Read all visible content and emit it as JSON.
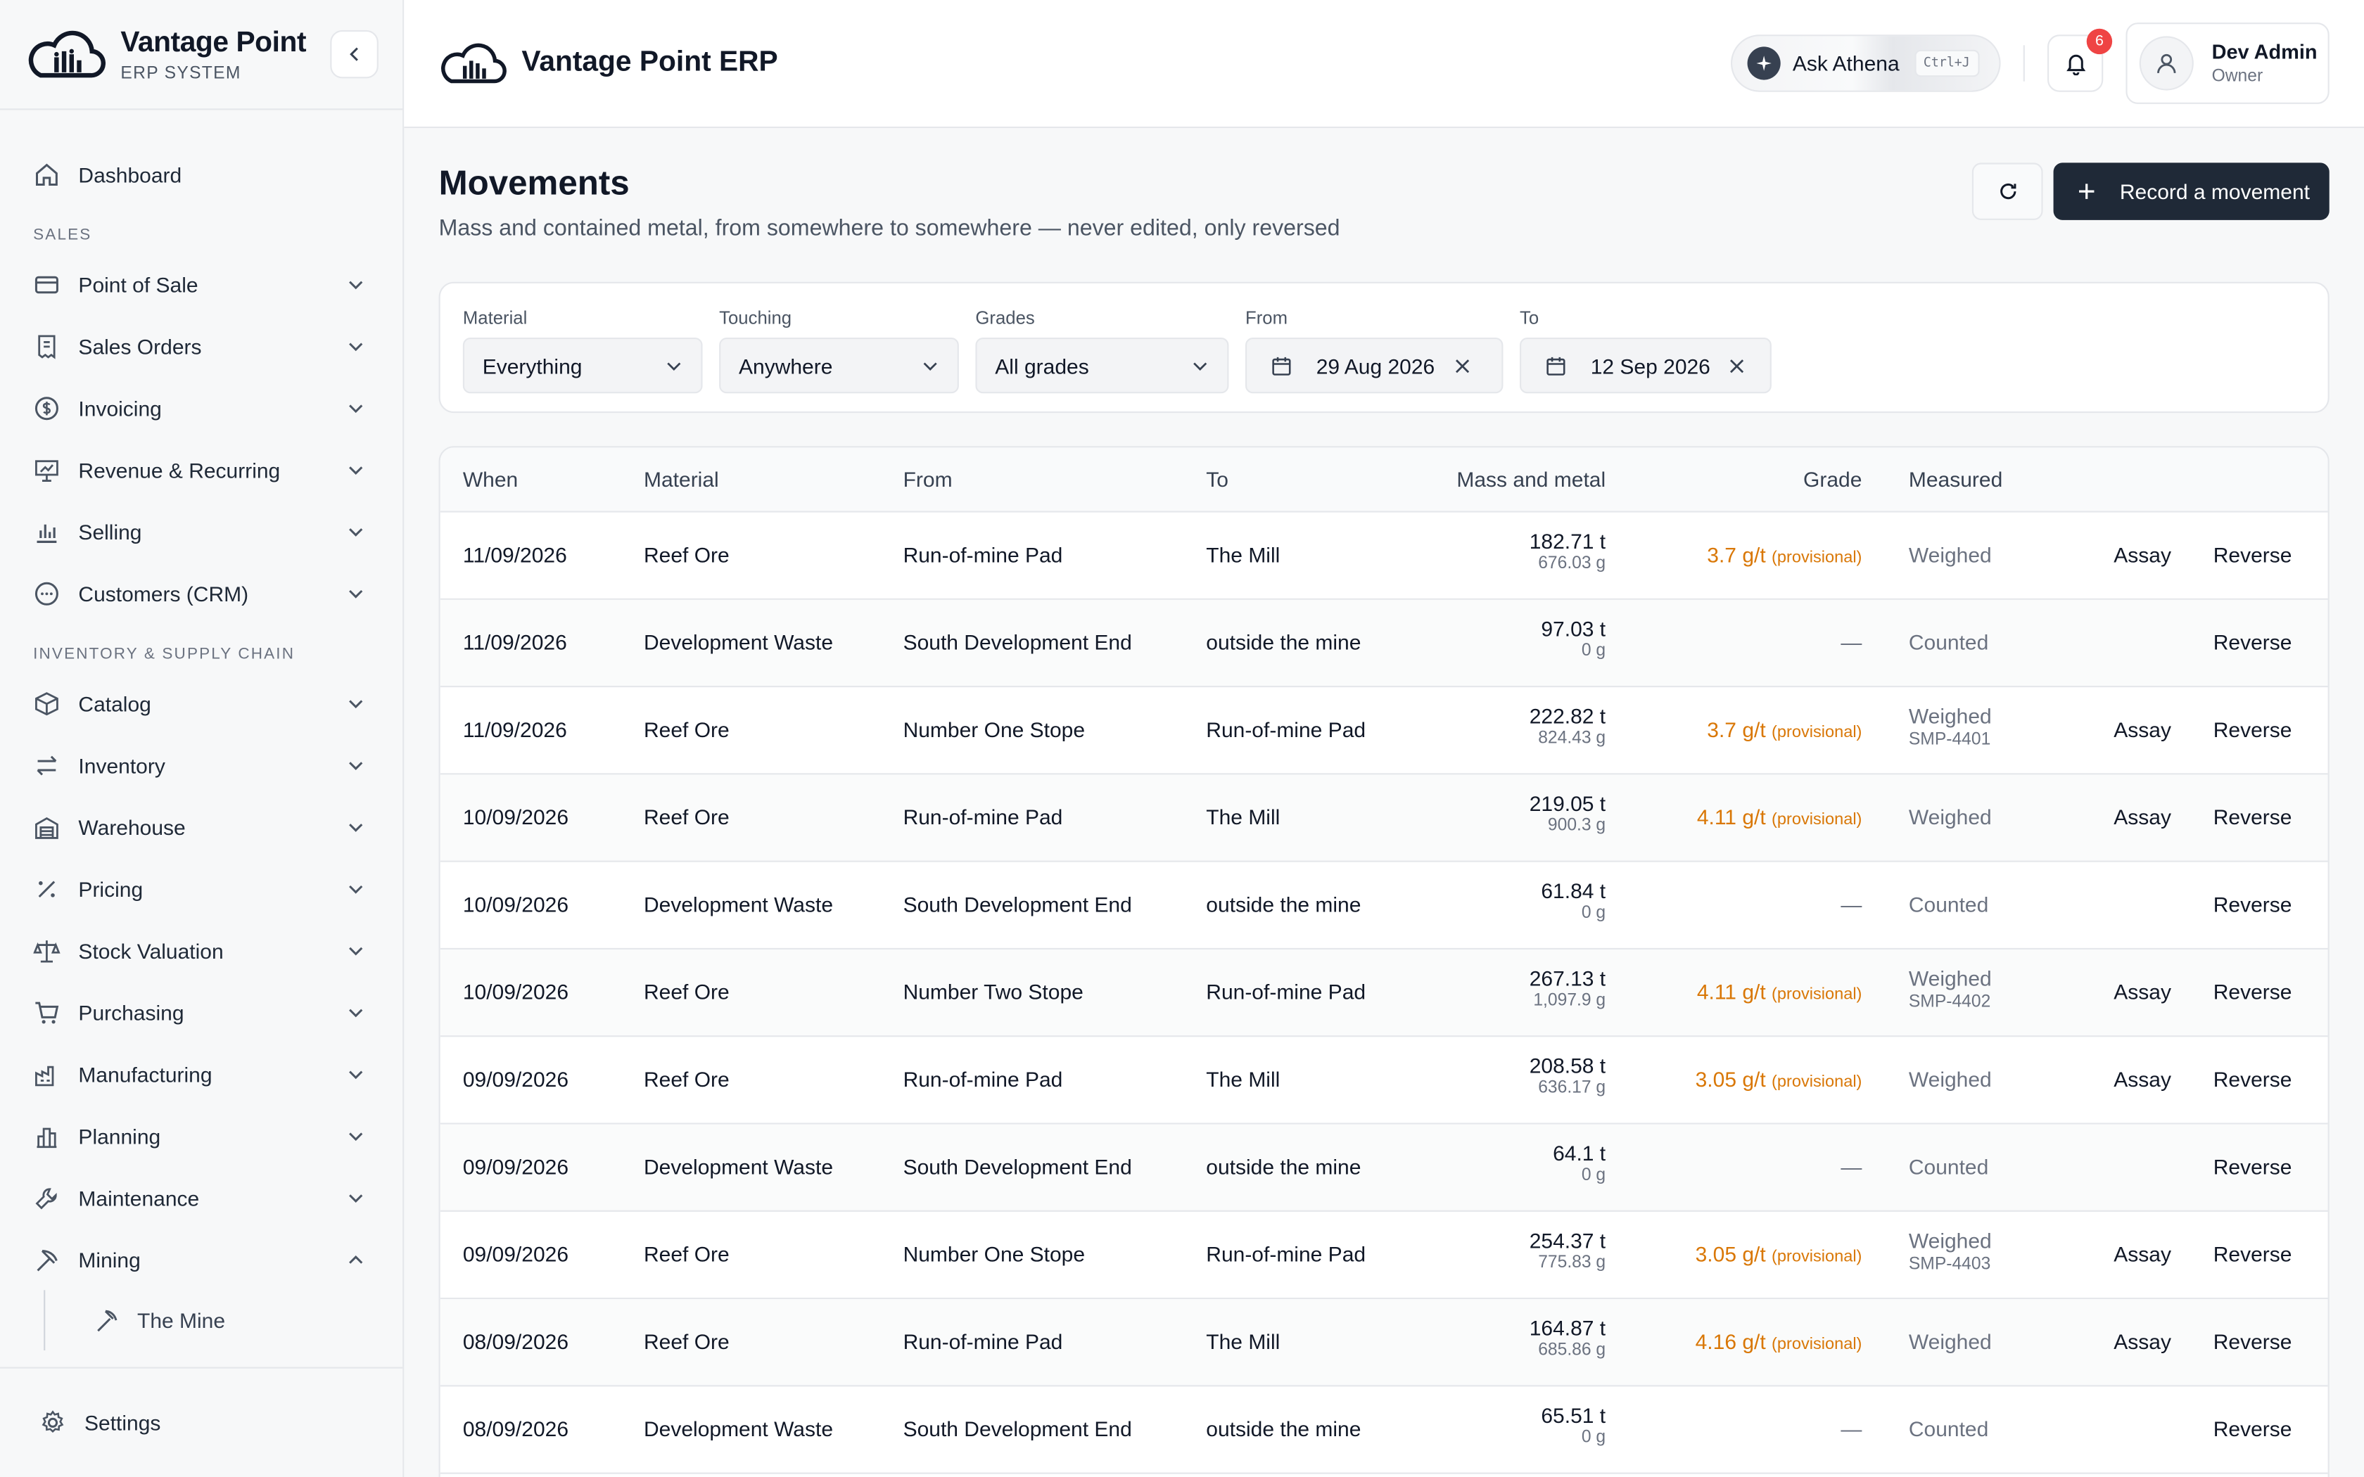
{
  "brand": {
    "title": "Vantage Point",
    "subtitle": "ERP SYSTEM"
  },
  "header": {
    "title": "Vantage Point ERP",
    "ask_label": "Ask Athena",
    "ask_shortcut": "Ctrl+J",
    "notification_count": "6",
    "user_name": "Dev Admin",
    "user_role": "Owner"
  },
  "sidebar": {
    "dashboard": "Dashboard",
    "sales_label": "SALES",
    "sales_items": [
      {
        "label": "Point of Sale",
        "icon": "credit-card-icon"
      },
      {
        "label": "Sales Orders",
        "icon": "receipt-icon"
      },
      {
        "label": "Invoicing",
        "icon": "dollar-circle-icon"
      },
      {
        "label": "Revenue & Recurring",
        "icon": "presentation-chart-icon"
      },
      {
        "label": "Selling",
        "icon": "bar-chart-icon"
      },
      {
        "label": "Customers (CRM)",
        "icon": "chat-icon"
      }
    ],
    "inventory_label": "INVENTORY & SUPPLY CHAIN",
    "inventory_items": [
      {
        "label": "Catalog",
        "icon": "box-icon"
      },
      {
        "label": "Inventory",
        "icon": "arrows-icon"
      },
      {
        "label": "Warehouse",
        "icon": "warehouse-icon"
      },
      {
        "label": "Pricing",
        "icon": "percent-icon"
      },
      {
        "label": "Stock Valuation",
        "icon": "scale-icon"
      },
      {
        "label": "Purchasing",
        "icon": "cart-icon"
      },
      {
        "label": "Manufacturing",
        "icon": "factory-icon"
      },
      {
        "label": "Planning",
        "icon": "columns-icon"
      },
      {
        "label": "Maintenance",
        "icon": "wrench-icon"
      },
      {
        "label": "Mining",
        "icon": "pickaxe-icon"
      }
    ],
    "sub_item": "The Mine",
    "settings": "Settings"
  },
  "page": {
    "title": "Movements",
    "subtitle": "Mass and contained metal, from somewhere to somewhere — never edited, only reversed",
    "record_button": "Record a movement"
  },
  "filters": {
    "material_label": "Material",
    "material_value": "Everything",
    "touching_label": "Touching",
    "touching_value": "Anywhere",
    "grades_label": "Grades",
    "grades_value": "All grades",
    "from_label": "From",
    "from_value": "29 Aug 2026",
    "to_label": "To",
    "to_value": "12 Sep 2026"
  },
  "table": {
    "headers": {
      "when": "When",
      "material": "Material",
      "from": "From",
      "to": "To",
      "mass": "Mass and metal",
      "grade": "Grade",
      "measured": "Measured"
    },
    "assay_label": "Assay",
    "reverse_label": "Reverse",
    "rows": [
      {
        "when": "11/09/2026",
        "material": "Reef Ore",
        "from": "Run-of-mine Pad",
        "to": "The Mill",
        "mass": "182.71 t",
        "metal": "676.03 g",
        "grade": "3.7 g/t",
        "provisional": "(provisional)",
        "measured": "Weighed",
        "sample": "",
        "assay": true
      },
      {
        "when": "11/09/2026",
        "material": "Development Waste",
        "from": "South Development End",
        "to": "outside the mine",
        "mass": "97.03 t",
        "metal": "0 g",
        "grade": "—",
        "provisional": "",
        "measured": "Counted",
        "sample": "",
        "assay": false
      },
      {
        "when": "11/09/2026",
        "material": "Reef Ore",
        "from": "Number One Stope",
        "to": "Run-of-mine Pad",
        "mass": "222.82 t",
        "metal": "824.43 g",
        "grade": "3.7 g/t",
        "provisional": "(provisional)",
        "measured": "Weighed",
        "sample": "SMP-4401",
        "assay": true
      },
      {
        "when": "10/09/2026",
        "material": "Reef Ore",
        "from": "Run-of-mine Pad",
        "to": "The Mill",
        "mass": "219.05 t",
        "metal": "900.3 g",
        "grade": "4.11 g/t",
        "provisional": "(provisional)",
        "measured": "Weighed",
        "sample": "",
        "assay": true
      },
      {
        "when": "10/09/2026",
        "material": "Development Waste",
        "from": "South Development End",
        "to": "outside the mine",
        "mass": "61.84 t",
        "metal": "0 g",
        "grade": "—",
        "provisional": "",
        "measured": "Counted",
        "sample": "",
        "assay": false
      },
      {
        "when": "10/09/2026",
        "material": "Reef Ore",
        "from": "Number Two Stope",
        "to": "Run-of-mine Pad",
        "mass": "267.13 t",
        "metal": "1,097.9 g",
        "grade": "4.11 g/t",
        "provisional": "(provisional)",
        "measured": "Weighed",
        "sample": "SMP-4402",
        "assay": true
      },
      {
        "when": "09/09/2026",
        "material": "Reef Ore",
        "from": "Run-of-mine Pad",
        "to": "The Mill",
        "mass": "208.58 t",
        "metal": "636.17 g",
        "grade": "3.05 g/t",
        "provisional": "(provisional)",
        "measured": "Weighed",
        "sample": "",
        "assay": true
      },
      {
        "when": "09/09/2026",
        "material": "Development Waste",
        "from": "South Development End",
        "to": "outside the mine",
        "mass": "64.1 t",
        "metal": "0 g",
        "grade": "—",
        "provisional": "",
        "measured": "Counted",
        "sample": "",
        "assay": false
      },
      {
        "when": "09/09/2026",
        "material": "Reef Ore",
        "from": "Number One Stope",
        "to": "Run-of-mine Pad",
        "mass": "254.37 t",
        "metal": "775.83 g",
        "grade": "3.05 g/t",
        "provisional": "(provisional)",
        "measured": "Weighed",
        "sample": "SMP-4403",
        "assay": true
      },
      {
        "when": "08/09/2026",
        "material": "Reef Ore",
        "from": "Run-of-mine Pad",
        "to": "The Mill",
        "mass": "164.87 t",
        "metal": "685.86 g",
        "grade": "4.16 g/t",
        "provisional": "(provisional)",
        "measured": "Weighed",
        "sample": "",
        "assay": true
      },
      {
        "when": "08/09/2026",
        "material": "Development Waste",
        "from": "South Development End",
        "to": "outside the mine",
        "mass": "65.51 t",
        "metal": "0 g",
        "grade": "—",
        "provisional": "",
        "measured": "Counted",
        "sample": "",
        "assay": false
      }
    ]
  },
  "colors": {
    "accent": "#1f2937",
    "grade": "#d97706",
    "badge": "#ef4444"
  }
}
